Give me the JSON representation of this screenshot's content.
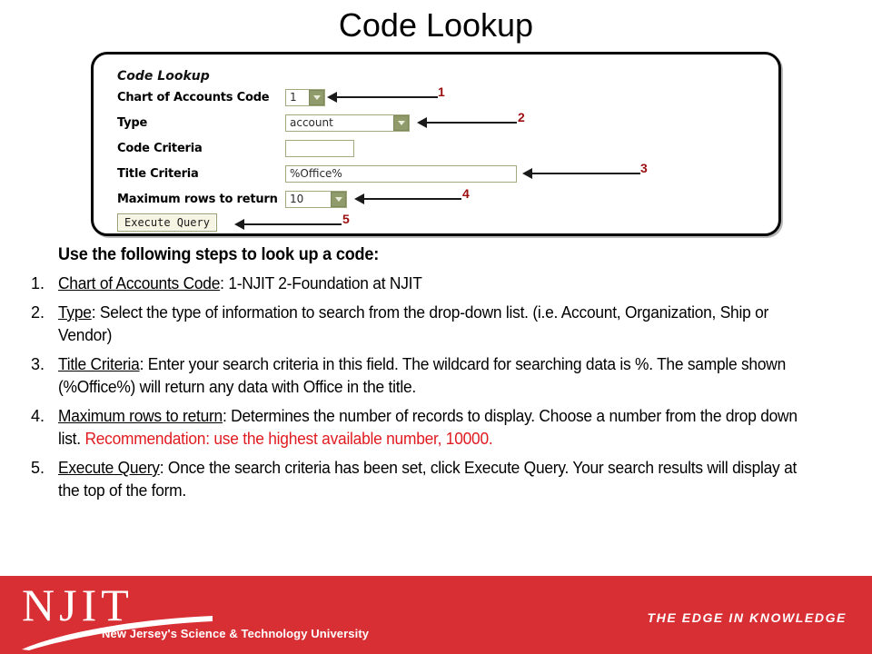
{
  "slide": {
    "title": "Code Lookup"
  },
  "form": {
    "heading": "Code Lookup",
    "rows": [
      {
        "label": "Chart of Accounts Code",
        "control": "select",
        "value": "1",
        "callout": "1"
      },
      {
        "label": "Type",
        "control": "select",
        "value": "account",
        "callout": "2"
      },
      {
        "label": "Code Criteria",
        "control": "text",
        "value": "",
        "callout": ""
      },
      {
        "label": "Title Criteria",
        "control": "text",
        "value": "%Office%",
        "callout": "3"
      },
      {
        "label": "Maximum rows to return",
        "control": "select",
        "value": "10",
        "callout": "4"
      }
    ],
    "submit_label": "Execute Query",
    "submit_callout": "5"
  },
  "body": {
    "lead": "Use the following steps to look up a code:",
    "steps": [
      {
        "number": "1.",
        "term": "Chart of Accounts Code",
        "text": ":  1-NJIT 2-Foundation at NJIT",
        "red_text": ""
      },
      {
        "number": "2.",
        "term": "Type",
        "text": ":  Select the type of information to search from the drop-down list.  (i.e. Account, Organization, Ship or Vendor)",
        "red_text": ""
      },
      {
        "number": "3.",
        "term": "Title Criteria",
        "text": ":  Enter your search criteria in this field.  The wildcard for searching data is %.  The sample shown (%Office%) will return any data with Office in the title.",
        "red_text": ""
      },
      {
        "number": "4.",
        "term": "Maximum rows to return",
        "text": ":  Determines the number of records to display.  Choose a number from the drop down list. ",
        "red_text": "Recommendation: use the highest available number, 10000."
      },
      {
        "number": "5.",
        "term": "Execute Query",
        "text": ":  Once the search criteria has been set, click Execute Query.  Your search results will display at the top of the form.",
        "red_text": ""
      }
    ]
  },
  "footer": {
    "logo_letters": "NJIT",
    "logo_tagline": "New Jersey's Science & Technology University",
    "edge_tagline": "THE EDGE IN KNOWLEDGE",
    "background_color": "#d82f34"
  },
  "colors": {
    "brand_red": "#d82f34",
    "callout_red": "#9c0d10",
    "highlight_red": "#e01b20",
    "control_border": "#a3a87e",
    "dropdown_button": "#8f9b6b",
    "button_face": "#f6f4e2"
  }
}
